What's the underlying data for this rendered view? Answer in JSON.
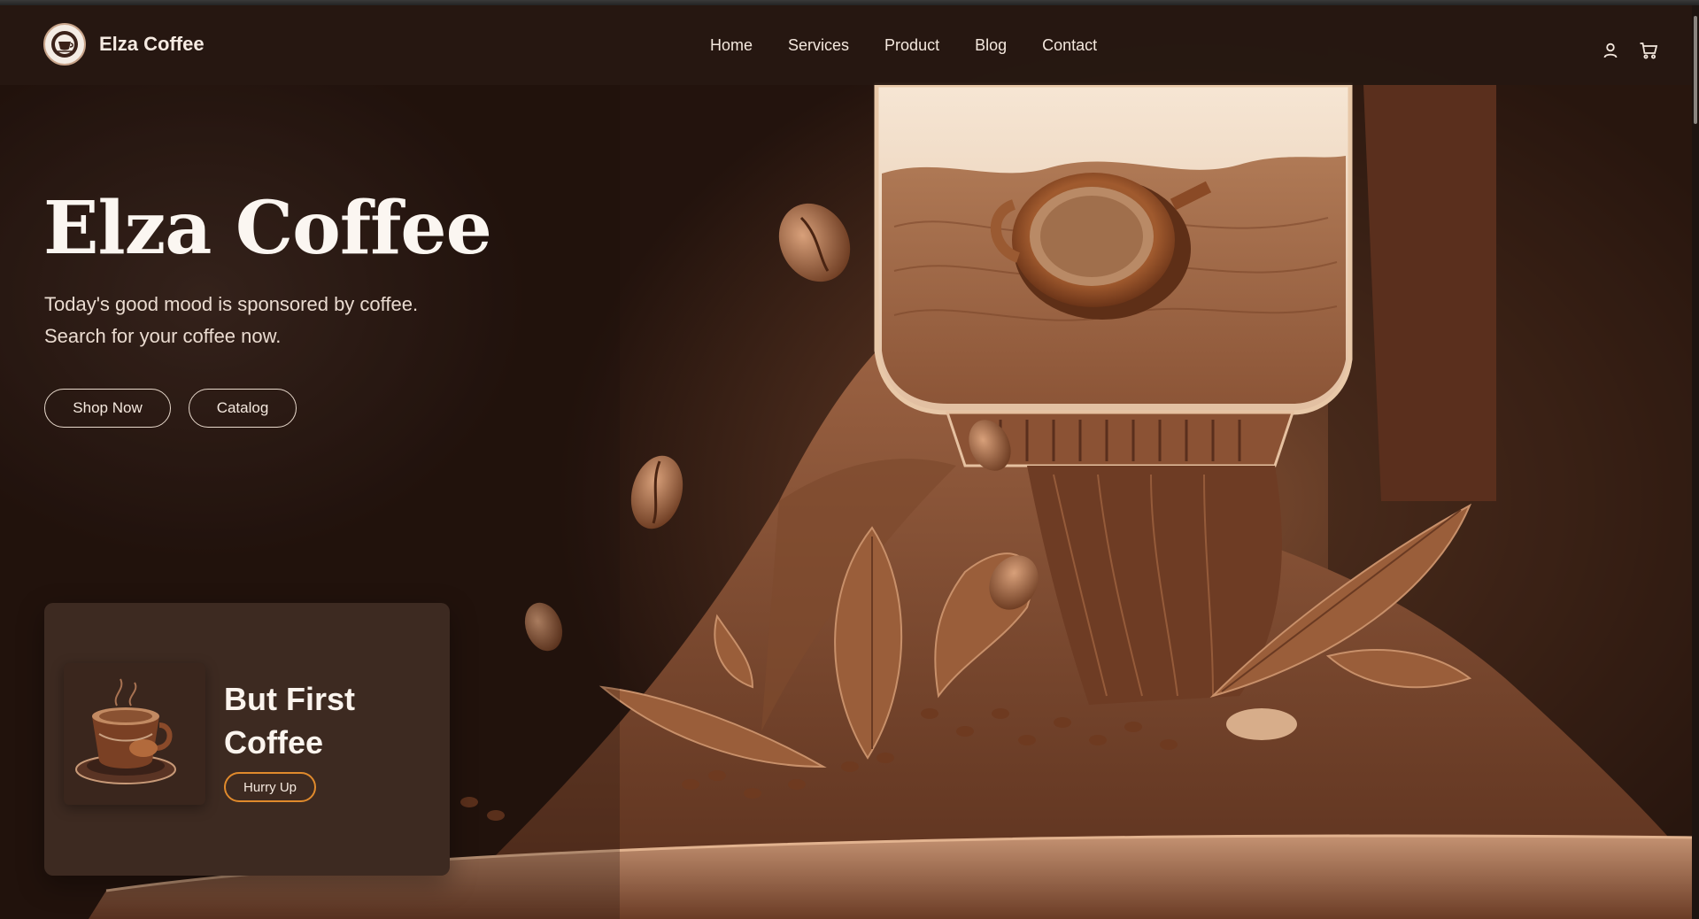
{
  "brand": {
    "name": "Elza Coffee",
    "logo_icon": "coffee-cup-logo-icon"
  },
  "nav": {
    "links": [
      "Home",
      "Services",
      "Product",
      "Blog",
      "Contact"
    ],
    "icons": [
      "user-icon",
      "cart-icon"
    ]
  },
  "hero": {
    "title": "Elza Coffee",
    "subtitle_lines": [
      "Today's good mood is sponsored by coffee.",
      "Search for your coffee now."
    ],
    "buttons": {
      "shop": "Shop Now",
      "catalog": "Catalog"
    },
    "background_image": "coffee-grinder-illustration"
  },
  "promo": {
    "title": "But First Coffee",
    "button": "Hurry Up",
    "image": "coffee-cup-image"
  },
  "colors": {
    "navbar": "#261812",
    "card": "#3d2a21",
    "accent_orange": "#e08a2c",
    "text_light": "#f4e8de"
  }
}
